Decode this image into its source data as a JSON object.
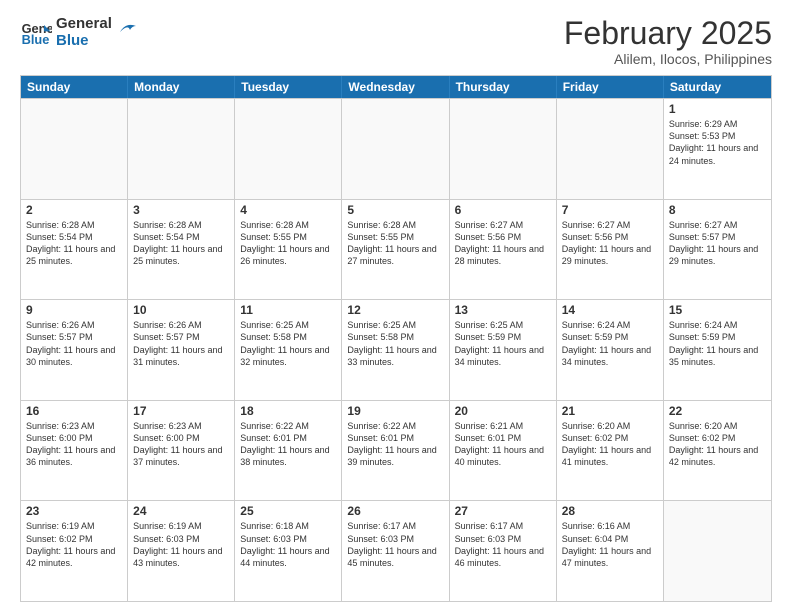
{
  "logo": {
    "line1": "General",
    "line2": "Blue"
  },
  "title": "February 2025",
  "subtitle": "Alilem, Ilocos, Philippines",
  "days": [
    "Sunday",
    "Monday",
    "Tuesday",
    "Wednesday",
    "Thursday",
    "Friday",
    "Saturday"
  ],
  "weeks": [
    [
      {
        "day": "",
        "info": ""
      },
      {
        "day": "",
        "info": ""
      },
      {
        "day": "",
        "info": ""
      },
      {
        "day": "",
        "info": ""
      },
      {
        "day": "",
        "info": ""
      },
      {
        "day": "",
        "info": ""
      },
      {
        "day": "1",
        "info": "Sunrise: 6:29 AM\nSunset: 5:53 PM\nDaylight: 11 hours and 24 minutes."
      }
    ],
    [
      {
        "day": "2",
        "info": "Sunrise: 6:28 AM\nSunset: 5:54 PM\nDaylight: 11 hours and 25 minutes."
      },
      {
        "day": "3",
        "info": "Sunrise: 6:28 AM\nSunset: 5:54 PM\nDaylight: 11 hours and 25 minutes."
      },
      {
        "day": "4",
        "info": "Sunrise: 6:28 AM\nSunset: 5:55 PM\nDaylight: 11 hours and 26 minutes."
      },
      {
        "day": "5",
        "info": "Sunrise: 6:28 AM\nSunset: 5:55 PM\nDaylight: 11 hours and 27 minutes."
      },
      {
        "day": "6",
        "info": "Sunrise: 6:27 AM\nSunset: 5:56 PM\nDaylight: 11 hours and 28 minutes."
      },
      {
        "day": "7",
        "info": "Sunrise: 6:27 AM\nSunset: 5:56 PM\nDaylight: 11 hours and 29 minutes."
      },
      {
        "day": "8",
        "info": "Sunrise: 6:27 AM\nSunset: 5:57 PM\nDaylight: 11 hours and 29 minutes."
      }
    ],
    [
      {
        "day": "9",
        "info": "Sunrise: 6:26 AM\nSunset: 5:57 PM\nDaylight: 11 hours and 30 minutes."
      },
      {
        "day": "10",
        "info": "Sunrise: 6:26 AM\nSunset: 5:57 PM\nDaylight: 11 hours and 31 minutes."
      },
      {
        "day": "11",
        "info": "Sunrise: 6:25 AM\nSunset: 5:58 PM\nDaylight: 11 hours and 32 minutes."
      },
      {
        "day": "12",
        "info": "Sunrise: 6:25 AM\nSunset: 5:58 PM\nDaylight: 11 hours and 33 minutes."
      },
      {
        "day": "13",
        "info": "Sunrise: 6:25 AM\nSunset: 5:59 PM\nDaylight: 11 hours and 34 minutes."
      },
      {
        "day": "14",
        "info": "Sunrise: 6:24 AM\nSunset: 5:59 PM\nDaylight: 11 hours and 34 minutes."
      },
      {
        "day": "15",
        "info": "Sunrise: 6:24 AM\nSunset: 5:59 PM\nDaylight: 11 hours and 35 minutes."
      }
    ],
    [
      {
        "day": "16",
        "info": "Sunrise: 6:23 AM\nSunset: 6:00 PM\nDaylight: 11 hours and 36 minutes."
      },
      {
        "day": "17",
        "info": "Sunrise: 6:23 AM\nSunset: 6:00 PM\nDaylight: 11 hours and 37 minutes."
      },
      {
        "day": "18",
        "info": "Sunrise: 6:22 AM\nSunset: 6:01 PM\nDaylight: 11 hours and 38 minutes."
      },
      {
        "day": "19",
        "info": "Sunrise: 6:22 AM\nSunset: 6:01 PM\nDaylight: 11 hours and 39 minutes."
      },
      {
        "day": "20",
        "info": "Sunrise: 6:21 AM\nSunset: 6:01 PM\nDaylight: 11 hours and 40 minutes."
      },
      {
        "day": "21",
        "info": "Sunrise: 6:20 AM\nSunset: 6:02 PM\nDaylight: 11 hours and 41 minutes."
      },
      {
        "day": "22",
        "info": "Sunrise: 6:20 AM\nSunset: 6:02 PM\nDaylight: 11 hours and 42 minutes."
      }
    ],
    [
      {
        "day": "23",
        "info": "Sunrise: 6:19 AM\nSunset: 6:02 PM\nDaylight: 11 hours and 42 minutes."
      },
      {
        "day": "24",
        "info": "Sunrise: 6:19 AM\nSunset: 6:03 PM\nDaylight: 11 hours and 43 minutes."
      },
      {
        "day": "25",
        "info": "Sunrise: 6:18 AM\nSunset: 6:03 PM\nDaylight: 11 hours and 44 minutes."
      },
      {
        "day": "26",
        "info": "Sunrise: 6:17 AM\nSunset: 6:03 PM\nDaylight: 11 hours and 45 minutes."
      },
      {
        "day": "27",
        "info": "Sunrise: 6:17 AM\nSunset: 6:03 PM\nDaylight: 11 hours and 46 minutes."
      },
      {
        "day": "28",
        "info": "Sunrise: 6:16 AM\nSunset: 6:04 PM\nDaylight: 11 hours and 47 minutes."
      },
      {
        "day": "",
        "info": ""
      }
    ]
  ]
}
